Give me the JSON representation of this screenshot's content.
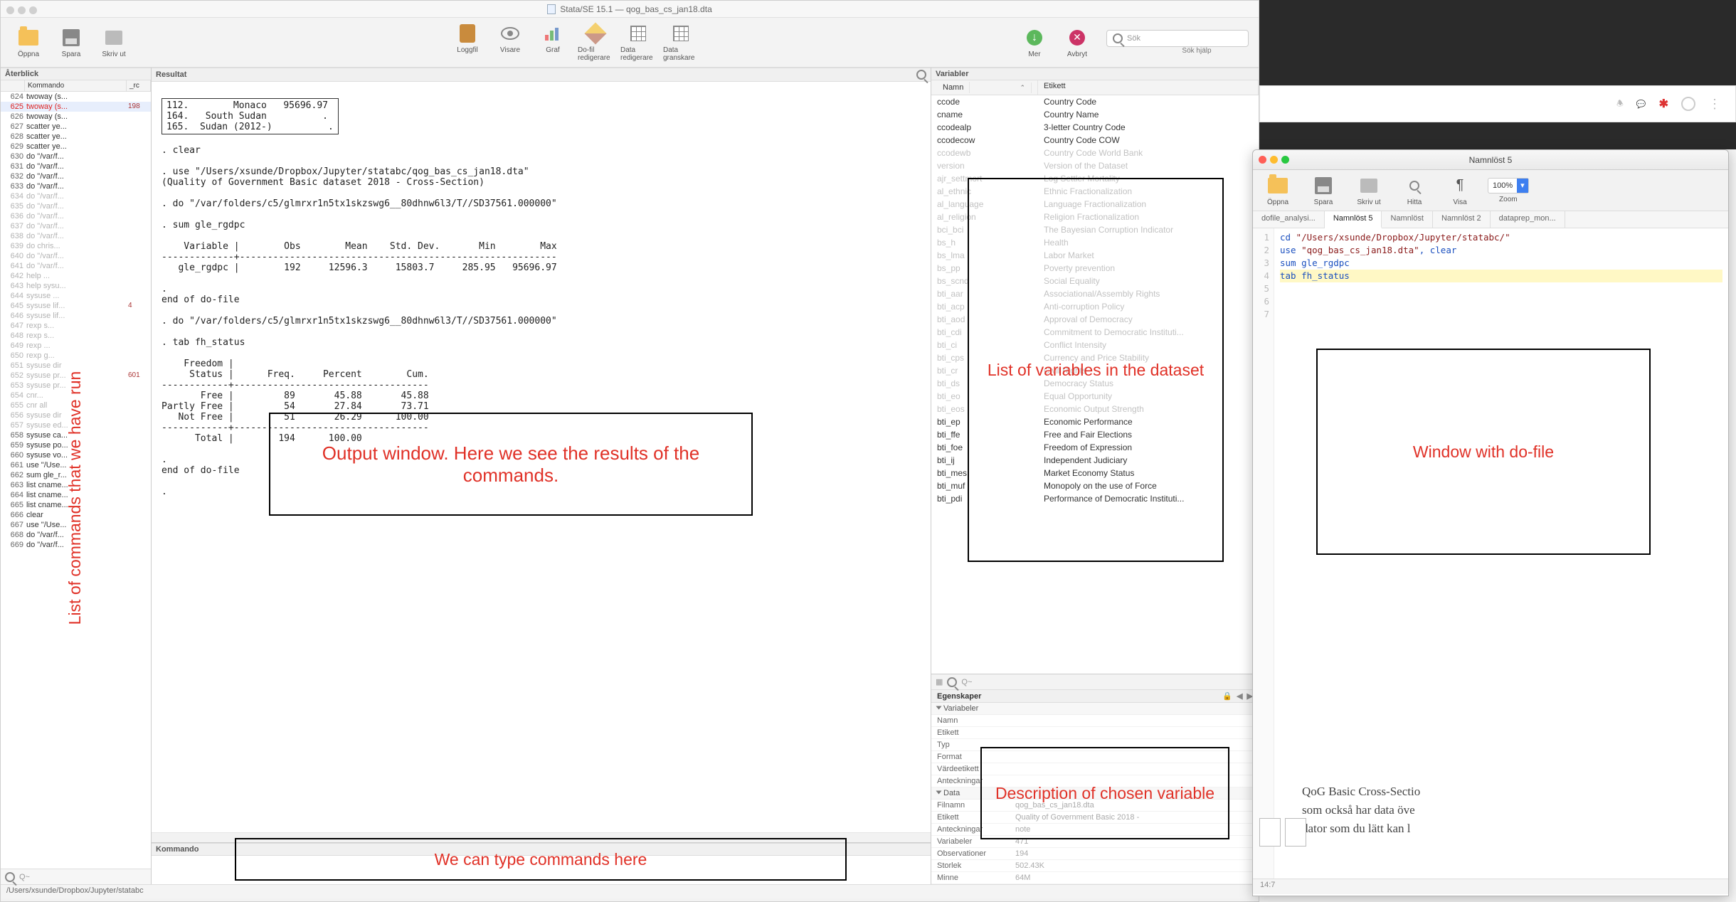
{
  "stata": {
    "title": "Stata/SE 15.1 — qog_bas_cs_jan18.dta",
    "toolbar": {
      "open": "Öppna",
      "save": "Spara",
      "print": "Skriv ut",
      "log": "Loggfil",
      "viewer": "Visare",
      "graph": "Graf",
      "doedit": "Do-fil redigerare",
      "dataedit": "Data redigerare",
      "databrowse": "Data granskare",
      "more": "Mer",
      "break": "Avbryt",
      "search_ph": "Sök",
      "search_help": "Sök hjälp"
    },
    "review": {
      "title": "Återblick",
      "cols": {
        "cmd": "Kommando",
        "rc": "_rc"
      },
      "rows": [
        {
          "n": 624,
          "c": "twoway (s..."
        },
        {
          "n": 625,
          "c": "twoway (s...",
          "rc": "198",
          "err": true,
          "sel": true
        },
        {
          "n": 626,
          "c": "twoway (s..."
        },
        {
          "n": 627,
          "c": "scatter ye..."
        },
        {
          "n": 628,
          "c": "scatter ye..."
        },
        {
          "n": 629,
          "c": "scatter ye..."
        },
        {
          "n": 630,
          "c": "do \"/var/f..."
        },
        {
          "n": 631,
          "c": "do \"/var/f..."
        },
        {
          "n": 632,
          "c": "do \"/var/f..."
        },
        {
          "n": 633,
          "c": "do \"/var/f..."
        },
        {
          "n": 634,
          "c": "do \"/var/f...",
          "grey": true
        },
        {
          "n": 635,
          "c": "do \"/var/f...",
          "grey": true
        },
        {
          "n": 636,
          "c": "do \"/var/f...",
          "grey": true
        },
        {
          "n": 637,
          "c": "do \"/var/f...",
          "grey": true
        },
        {
          "n": 638,
          "c": "do \"/var/f...",
          "grey": true
        },
        {
          "n": 639,
          "c": "do chris...",
          "grey": true
        },
        {
          "n": 640,
          "c": "do \"/var/f...",
          "grey": true
        },
        {
          "n": 641,
          "c": "do \"/var/f...",
          "grey": true
        },
        {
          "n": 642,
          "c": "help ...",
          "grey": true
        },
        {
          "n": 643,
          "c": "help sysu...",
          "grey": true
        },
        {
          "n": 644,
          "c": "sysuse ...",
          "grey": true
        },
        {
          "n": 645,
          "c": "sysuse lif...",
          "rc": "4",
          "err": true,
          "grey": true
        },
        {
          "n": 646,
          "c": "sysuse lif...",
          "grey": true
        },
        {
          "n": 647,
          "c": "rexp s...",
          "grey": true
        },
        {
          "n": 648,
          "c": "rexp s...",
          "grey": true
        },
        {
          "n": 649,
          "c": "rexp ...",
          "grey": true
        },
        {
          "n": 650,
          "c": "rexp g...",
          "grey": true
        },
        {
          "n": 651,
          "c": "sysuse dir",
          "grey": true
        },
        {
          "n": 652,
          "c": "sysuse pr...",
          "rc": "601",
          "err": true,
          "grey": true
        },
        {
          "n": 653,
          "c": "sysuse pr...",
          "grey": true
        },
        {
          "n": 654,
          "c": "cnr...",
          "grey": true
        },
        {
          "n": 655,
          "c": "cnr all",
          "grey": true
        },
        {
          "n": 656,
          "c": "sysuse dir",
          "grey": true
        },
        {
          "n": 657,
          "c": "sysuse ed...",
          "grey": true
        },
        {
          "n": 658,
          "c": "sysuse ca..."
        },
        {
          "n": 659,
          "c": "sysuse po..."
        },
        {
          "n": 660,
          "c": "sysuse vo..."
        },
        {
          "n": 661,
          "c": "use \"/Use..."
        },
        {
          "n": 662,
          "c": "sum gle_r..."
        },
        {
          "n": 663,
          "c": "list cname..."
        },
        {
          "n": 664,
          "c": "list cname..."
        },
        {
          "n": 665,
          "c": "list cname..."
        },
        {
          "n": 666,
          "c": "clear"
        },
        {
          "n": 667,
          "c": "use \"/Use..."
        },
        {
          "n": 668,
          "c": "do \"/var/f..."
        },
        {
          "n": 669,
          "c": "do \"/var/f..."
        }
      ],
      "footer_ph": "Q~"
    },
    "results": {
      "title": "Resultat",
      "top_box": "112.        Monaco   95696.97\n164.   South Sudan          .\n165.  Sudan (2012-)          .",
      "lines": [
        "",
        ". clear",
        "",
        ". use \"/Users/xsunde/Dropbox/Jupyter/statabc/qog_bas_cs_jan18.dta\"",
        "(Quality of Government Basic dataset 2018 - Cross-Section)",
        "",
        ". do \"/var/folders/c5/glmrxr1n5tx1skzswg6__80dhnw6l3/T//SD37561.000000\"",
        "",
        ". sum gle_rgdpc",
        "",
        "    Variable |        Obs        Mean    Std. Dev.       Min        Max",
        "-------------+---------------------------------------------------------",
        "   gle_rgdpc |        192     12596.3     15803.7     285.95   95696.97",
        "",
        ".",
        "end of do-file",
        "",
        ". do \"/var/folders/c5/glmrxr1n5tx1skzswg6__80dhnw6l3/T//SD37561.000000\"",
        "",
        ". tab fh_status",
        "",
        "    Freedom |",
        "     Status |      Freq.     Percent        Cum.",
        "------------+-----------------------------------",
        "       Free |         89       45.88       45.88",
        "Partly Free |         54       27.84       73.71",
        "   Not Free |         51       26.29      100.00",
        "------------+-----------------------------------",
        "      Total |        194      100.00",
        "",
        ".",
        "end of do-file",
        "",
        "."
      ],
      "cmd_title": "Kommando",
      "path": "/Users/xsunde/Dropbox/Jupyter/statabc"
    },
    "vars": {
      "title": "Variabler",
      "cols": {
        "name": "Namn",
        "label": "Etikett"
      },
      "rows": [
        {
          "n": "ccode",
          "l": "Country Code"
        },
        {
          "n": "cname",
          "l": "Country Name"
        },
        {
          "n": "ccodealp",
          "l": "3-letter Country Code"
        },
        {
          "n": "ccodecow",
          "l": "Country Code COW"
        },
        {
          "n": "ccodewb",
          "l": "Country Code World Bank",
          "dim": true
        },
        {
          "n": "version",
          "l": "Version of the Dataset",
          "dim": true
        },
        {
          "n": "ajr_settmort",
          "l": "Log Settler Mortality",
          "dim": true
        },
        {
          "n": "al_ethnic",
          "l": "Ethnic Fractionalization",
          "dim": true
        },
        {
          "n": "al_language",
          "l": "Language Fractionalization",
          "dim": true
        },
        {
          "n": "al_religion",
          "l": "Religion Fractionalization",
          "dim": true
        },
        {
          "n": "bci_bci",
          "l": "The Bayesian Corruption Indicator",
          "dim": true
        },
        {
          "n": "bs_h",
          "l": "Health",
          "dim": true
        },
        {
          "n": "bs_lma",
          "l": "Labor Market",
          "dim": true
        },
        {
          "n": "bs_pp",
          "l": "Poverty prevention",
          "dim": true
        },
        {
          "n": "bs_scnd",
          "l": "Social Equality",
          "dim": true
        },
        {
          "n": "bti_aar",
          "l": "Associational/Assembly Rights",
          "dim": true
        },
        {
          "n": "bti_acp",
          "l": "Anti-corruption Policy",
          "dim": true
        },
        {
          "n": "bti_aod",
          "l": "Approval of Democracy",
          "dim": true
        },
        {
          "n": "bti_cdi",
          "l": "Commitment to Democratic Instituti...",
          "dim": true
        },
        {
          "n": "bti_ci",
          "l": "Conflict Intensity",
          "dim": true
        },
        {
          "n": "bti_cps",
          "l": "Currency and Price Stability",
          "dim": true
        },
        {
          "n": "bti_cr",
          "l": "Civil Rights",
          "dim": true
        },
        {
          "n": "bti_ds",
          "l": "Democracy Status",
          "dim": true
        },
        {
          "n": "bti_eo",
          "l": "Equal Opportunity",
          "dim": true
        },
        {
          "n": "bti_eos",
          "l": "Economic Output Strength",
          "dim": true
        },
        {
          "n": "bti_ep",
          "l": "Economic Performance"
        },
        {
          "n": "bti_ffe",
          "l": "Free and Fair Elections"
        },
        {
          "n": "bti_foe",
          "l": "Freedom of Expression"
        },
        {
          "n": "bti_ij",
          "l": "Independent Judiciary"
        },
        {
          "n": "bti_mes",
          "l": "Market Economy Status"
        },
        {
          "n": "bti_muf",
          "l": "Monopoly on the use of Force"
        },
        {
          "n": "bti_pdi",
          "l": "Performance of Democratic Instituti..."
        }
      ],
      "search_ph": "Q~"
    },
    "props": {
      "title": "Egenskaper",
      "sec_var": "Variabeler",
      "rows_var": [
        {
          "k": "Namn",
          "v": ""
        },
        {
          "k": "Etikett",
          "v": ""
        },
        {
          "k": "Typ",
          "v": ""
        },
        {
          "k": "Format",
          "v": ""
        },
        {
          "k": "Värdeetikett",
          "v": ""
        },
        {
          "k": "Anteckningar",
          "v": ""
        }
      ],
      "sec_data": "Data",
      "rows_data": [
        {
          "k": "Filnamn",
          "v": "qog_bas_cs_jan18.dta"
        },
        {
          "k": "Etikett",
          "v": "Quality of Government Basic 2018 -"
        },
        {
          "k": "Anteckningar",
          "v": "note"
        },
        {
          "k": "Variabeler",
          "v": "471"
        },
        {
          "k": "Observationer",
          "v": "194"
        },
        {
          "k": "Storlek",
          "v": "502.43K"
        },
        {
          "k": "Minne",
          "v": "64M"
        }
      ]
    }
  },
  "dofile": {
    "title": "Namnlöst 5",
    "toolbar": {
      "open": "Öppna",
      "save": "Spara",
      "print": "Skriv ut",
      "find": "Hitta",
      "show": "Visa",
      "zoom": "Zoom",
      "zoom_val": "100%"
    },
    "tabs": [
      "dofile_analysi...",
      "Namnlöst 5",
      "Namnlöst",
      "Namnlöst 2",
      "dataprep_mon..."
    ],
    "active_tab": 1,
    "lines": [
      {
        "n": 1,
        "pre": "cd ",
        "str": "\"/Users/xsunde/Dropbox/Jupyter/statabc/\""
      },
      {
        "n": 2,
        "plain": ""
      },
      {
        "n": 3,
        "pre": "use ",
        "str": "\"qog_bas_cs_jan18.dta\"",
        "post": ", clear"
      },
      {
        "n": 4,
        "plain": ""
      },
      {
        "n": 5,
        "plain": "sum gle_rgdpc"
      },
      {
        "n": 6,
        "plain": ""
      },
      {
        "n": 7,
        "plain": "tab fh_status",
        "cur": true
      }
    ],
    "status": "14:7"
  },
  "doc_peek": {
    "l1": "QoG Basic Cross-Sectio",
    "l2": "som också har data öve",
    "l3": "dator som du lätt kan l"
  },
  "annotations": {
    "cmd_list": "List of commands that we have run",
    "output": "Output window. Here we see the results of the commands.",
    "cmd_input": "We can type commands here",
    "vars": "List of variables in the dataset",
    "props": "Description of chosen variable",
    "dofile": "Window with do-file"
  }
}
